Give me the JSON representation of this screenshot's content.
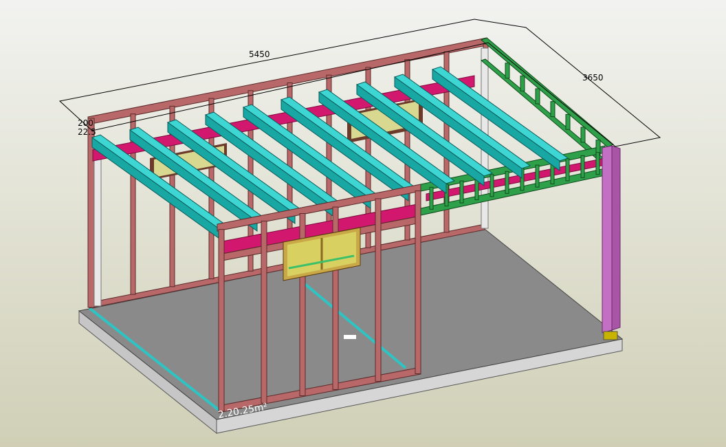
{
  "view": {
    "background_top": "#f2f3f0",
    "background_bottom": "#d0cfb6"
  },
  "dimensions": {
    "length": "5450",
    "width": "3650",
    "height_a": "200",
    "height_b": "22.5",
    "slab_label": "2.20.25m²"
  },
  "colors": {
    "wall_frame": "#b86868",
    "roof_rafter": "#19a7a4",
    "noggin": "#d2186e",
    "end_frame": "#2fa04a",
    "post": "#c26fc4",
    "window": "#c9b848",
    "slab_top": "#8a8a8a",
    "slab_side": "#c6c6c6",
    "plate": "#2ec4c4"
  }
}
